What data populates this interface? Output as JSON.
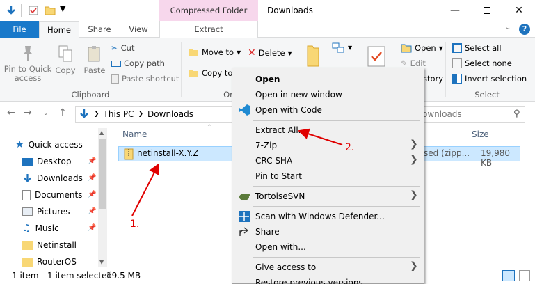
{
  "window": {
    "title": "Downloads",
    "contextual_tab_title": "Compressed Folder Tools"
  },
  "tabs": {
    "file": "File",
    "home": "Home",
    "share": "Share",
    "view": "View",
    "extract": "Extract"
  },
  "ribbon": {
    "pin_to_quick_access": "Pin to Quick access",
    "copy": "Copy",
    "paste": "Paste",
    "cut": "Cut",
    "copy_path": "Copy path",
    "paste_shortcut": "Paste shortcut",
    "clipboard_group": "Clipboard",
    "move_to": "Move to",
    "copy_to": "Copy to",
    "delete": "Delete",
    "organize_partial": "Or",
    "open": "Open",
    "edit": "Edit",
    "history_partial": "story",
    "select_all": "Select all",
    "select_none": "Select none",
    "invert_selection": "Invert selection",
    "select_group": "Select"
  },
  "address": {
    "crumbs": [
      "This PC",
      "Downloads"
    ],
    "search_partial": "ownloads"
  },
  "nav": {
    "items": [
      "Quick access",
      "Desktop",
      "Downloads",
      "Documents",
      "Pictures",
      "Music",
      "Netinstall",
      "RouterOS"
    ]
  },
  "filelist": {
    "col_name": "Name",
    "col_size": "Size",
    "file_name": "netinstall-X.Y.Z",
    "file_type_partial": "sed (zipp...",
    "file_size": "19,980 KB"
  },
  "status": {
    "item_count": "1 item",
    "selected": "1 item selected",
    "selected_size": "19.5 MB"
  },
  "context_menu": {
    "open": "Open",
    "open_new_window": "Open in new window",
    "open_with_code": "Open with Code",
    "extract_all": "Extract All...",
    "seven_zip": "7-Zip",
    "crc_sha": "CRC SHA",
    "pin_to_start": "Pin to Start",
    "tortoisesvn": "TortoiseSVN",
    "scan_defender": "Scan with Windows Defender...",
    "share": "Share",
    "open_with": "Open with...",
    "give_access": "Give access to",
    "restore_prev": "Restore previous versions"
  },
  "annotations": {
    "step1": "1.",
    "step2": "2."
  },
  "colors": {
    "accent": "#1979ca",
    "selection": "#cce8ff",
    "contextual": "#f7d7ec",
    "annotation": "#e00000"
  }
}
